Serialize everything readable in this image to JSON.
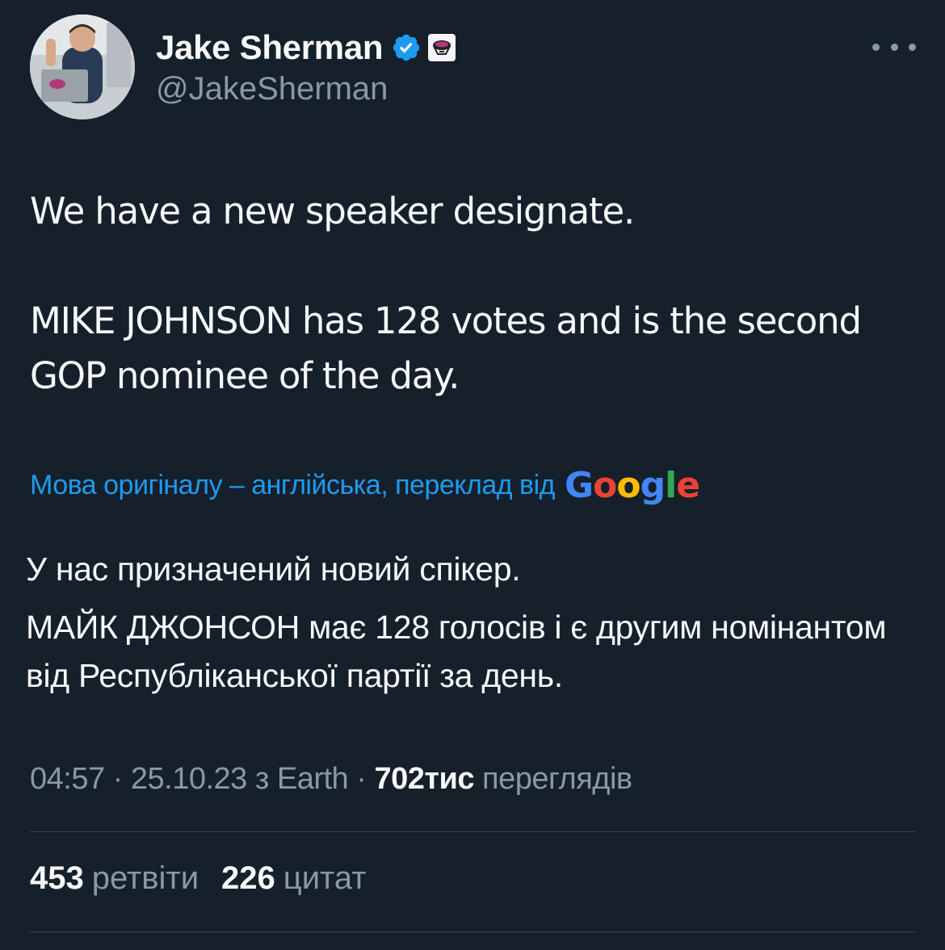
{
  "author": {
    "display_name": "Jake Sherman",
    "handle": "@JakeSherman"
  },
  "tweet": {
    "paragraphs": [
      "We have a new speaker designate.",
      "MIKE JOHNSON has 128 votes and is the second GOP nominee of the day."
    ]
  },
  "translation": {
    "notice": "Мова оригіналу – англійська, переклад від",
    "provider": "Google",
    "paragraphs": [
      "У нас призначений новий спікер.",
      "МАЙК ДЖОНСОН має 128 голосів і є другим номінантом від Республіканської партії за день."
    ]
  },
  "meta": {
    "time": "04:57",
    "separator": " · ",
    "date": "25.10.23",
    "source_prefix": "з",
    "source": "Earth",
    "views_count": "702тис",
    "views_label": "переглядів"
  },
  "stats": {
    "retweets_count": "453",
    "retweets_label": "ретвіти",
    "quotes_count": "226",
    "quotes_label": "цитат"
  },
  "colors": {
    "background": "#15202b",
    "text_primary": "#f7f9f9",
    "text_secondary": "#8b98a5",
    "link": "#1d9bf0",
    "verified": "#1d9bf0",
    "divider": "#38444d"
  },
  "icons": {
    "verified": "verified-badge-icon",
    "affiliate": "affiliate-badge-icon",
    "more": "more-options-icon"
  }
}
